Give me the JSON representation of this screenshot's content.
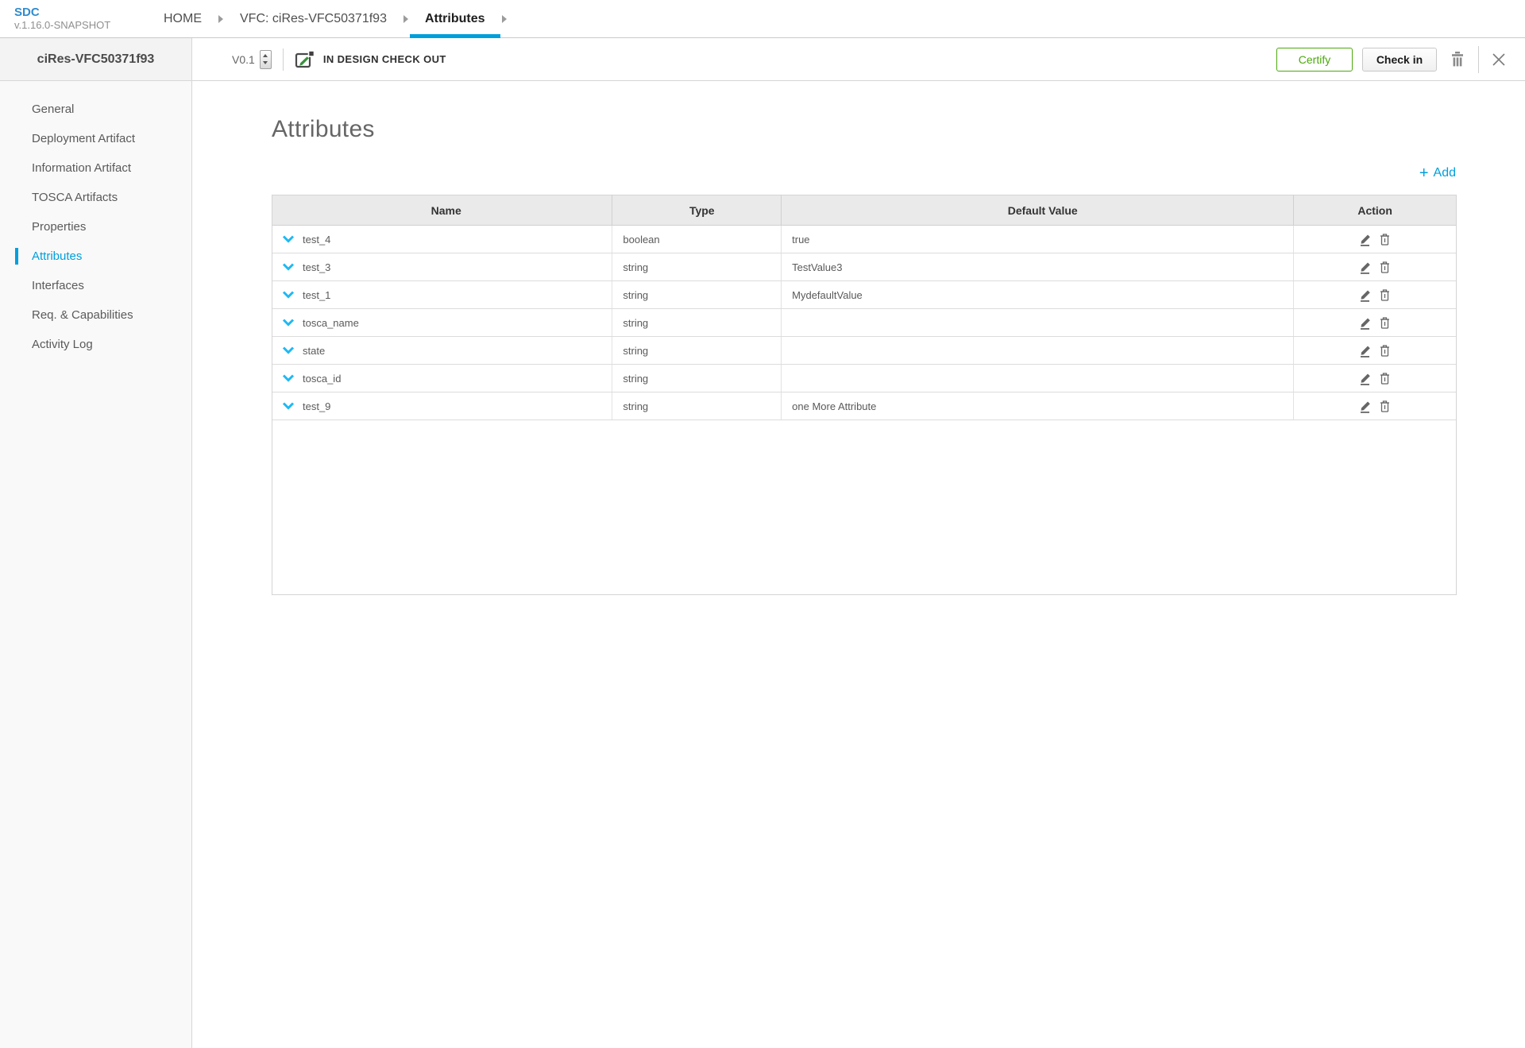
{
  "app": {
    "logo": "SDC",
    "version": "v.1.16.0-SNAPSHOT"
  },
  "breadcrumbs": [
    {
      "label": "HOME"
    },
    {
      "label": "VFC: ciRes-VFC50371f93"
    },
    {
      "label": "Attributes",
      "active": true
    }
  ],
  "sidebar": {
    "title": "ciRes-VFC50371f93",
    "items": [
      "General",
      "Deployment Artifact",
      "Information Artifact",
      "TOSCA Artifacts",
      "Properties",
      "Attributes",
      "Interfaces",
      "Req. & Capabilities",
      "Activity Log"
    ],
    "active_item": "Attributes"
  },
  "toolbar": {
    "version": "V0.1",
    "status": "IN DESIGN CHECK OUT",
    "certify_label": "Certify",
    "checkin_label": "Check in"
  },
  "page": {
    "title": "Attributes",
    "add_plus": "+",
    "add_label": "Add"
  },
  "table": {
    "columns": [
      "Name",
      "Type",
      "Default Value",
      "Action"
    ],
    "rows": [
      {
        "name": "test_4",
        "type": "boolean",
        "default": "true"
      },
      {
        "name": "test_3",
        "type": "string",
        "default": "TestValue3"
      },
      {
        "name": "test_1",
        "type": "string",
        "default": "MydefaultValue"
      },
      {
        "name": "tosca_name",
        "type": "string",
        "default": ""
      },
      {
        "name": "state",
        "type": "string",
        "default": ""
      },
      {
        "name": "tosca_id",
        "type": "string",
        "default": ""
      },
      {
        "name": "test_9",
        "type": "string",
        "default": "one More Attribute"
      }
    ]
  },
  "icons": {
    "chevron-down-icon": "v-shape chevron",
    "pencil-icon": "edit pencil with underline",
    "trash-icon": "trash can",
    "close-icon": "x cross",
    "checkout-pencil-icon": "square outline with green pencil",
    "arrow-right-icon": "small right triangle",
    "spinner-icon": "up/down stepper arrows",
    "plus-icon": "+"
  },
  "colors": {
    "accent_blue": "#009fdb",
    "chevron_blue": "#1eb9f3",
    "certify_green": "#4ca90c",
    "logo_blue": "#2f8cce"
  }
}
